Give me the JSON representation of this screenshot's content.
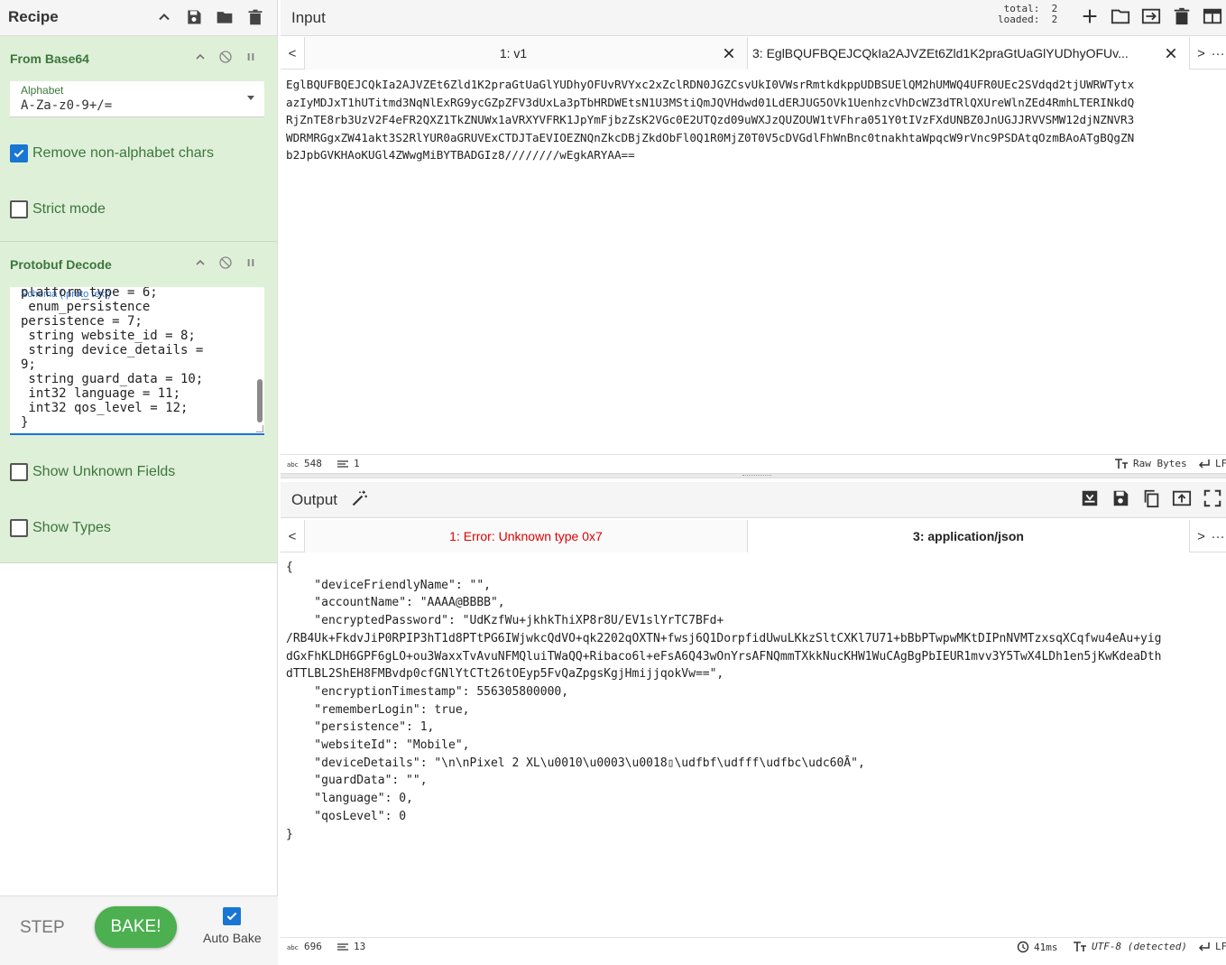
{
  "recipe": {
    "title": "Recipe",
    "from_base64": {
      "title": "From Base64",
      "alphabet_label": "Alphabet",
      "alphabet_value": "A-Za-z0-9+/=",
      "remove_non_alpha_label": "Remove non-alphabet chars",
      "remove_non_alpha_checked": true,
      "strict_mode_label": "Strict mode",
      "strict_mode_checked": false
    },
    "protobuf_decode": {
      "title": "Protobuf Decode",
      "schema_hint": "Schema (.proto text)",
      "schema_text": "platform_type = 6;\n enum_persistence\npersistence = 7;\n string website_id = 8;\n string device_details =\n9;\n string guard_data = 10;\n int32 language = 11;\n int32 qos_level = 12;\n}",
      "show_unknown_label": "Show Unknown Fields",
      "show_unknown_checked": false,
      "show_types_label": "Show Types",
      "show_types_checked": false
    },
    "controls": {
      "step_label": "STEP",
      "bake_label": "BAKE!",
      "auto_bake_label": "Auto Bake",
      "auto_bake_checked": true
    }
  },
  "input": {
    "title": "Input",
    "total_label": "total:",
    "total_value": "2",
    "loaded_label": "loaded:",
    "loaded_value": "2",
    "tab_prev": "<",
    "tab_next": ">",
    "tab_more": "···",
    "tabs": [
      {
        "label": "1: v1"
      },
      {
        "label": "3: EglBQUFBQEJCQkIa2AJVZEt6Zld1K2praGtUaGlYUDhyOFUv..."
      }
    ],
    "text": "EglBQUFBQEJCQkIa2AJVZEt6Zld1K2praGtUaGlYUDhyOFUvRVYxc2xZclRDN0JGZCsvUkI0VWsrRmtkdkppUDBSUElQM2hUMWQ4UFR0UEc2SVdqd2tjUWRWTytx\nazIyMDJxT1hUTitmd3NqNlExRG9ycGZpZFV3dUxLa3pTbHRDWEtsN1U3MStiQmJQVHdwd01LdERJUG5OVk1UenhzcVhDcWZ3dTRlQXUreWlnZEd4RmhLTERINkdQ\nRjZnTE8rb3UzV2F4eFR2QXZ1TkZNUWx1aVRXYVFRK1JpYmFjbzZsK2VGc0E2UTQzd09uWXJzQUZOUW1tVFhra051Y0tIVzFXdUNBZ0JnUGJJRVVSMW12djNZNVR3\nWDRMRGgxZW41akt3S2RlYUR0aGRUVExCTDJTaEVIOEZNQnZkcDBjZkdObFl0Q1R0MjZ0T0V5cDVGdlFhWnBnc0tnakhtaWpqcW9rVnc9PSDAtqOzmBAoATgBQgZN\nb2JpbGVKHAoKUGl4ZWwgMiBYTBADGIz8////////wEgkARYAA==",
    "status_chars": "548",
    "status_lines": "1",
    "status_format": "Raw Bytes",
    "status_eol": "LF"
  },
  "output": {
    "title": "Output",
    "tab_prev": "<",
    "tab_next": ">",
    "tab_more": "···",
    "tabs": [
      {
        "label": "1: Error: Unknown type 0x7",
        "color": "#e00000"
      },
      {
        "label": "3: application/json",
        "color": "#222222"
      }
    ],
    "text": "{\n    \"deviceFriendlyName\": \"\",\n    \"accountName\": \"AAAA@BBBB\",\n    \"encryptedPassword\": \"UdKzfWu+jkhkThiXP8r8U/EV1slYrTC7BFd+\n/RB4Uk+FkdvJiP0RPIP3hT1d8PTtPG6IWjwkcQdVO+qk2202qOXTN+fwsj6Q1DorpfidUwuLKkzSltCXKl7U71+bBbPTwpwMKtDIPnNVMTzxsqXCqfwu4eAu+yig\ndGxFhKLDH6GPF6gLO+ou3WaxxTvAvuNFMQluiTWaQQ+Ribaco6l+eFsA6Q43wOnYrsAFNQmmTXkkNucKHW1WuCAgBgPbIEUR1mvv3Y5TwX4LDh1en5jKwKdeaDth\ndTTLBL2ShEH8FMBvdp0cfGNlYtCTt26tOEyp5FvQaZpgsKgjHmijjqokVw==\",\n    \"encryptionTimestamp\": 556305800000,\n    \"rememberLogin\": true,\n    \"persistence\": 1,\n    \"websiteId\": \"Mobile\",\n    \"deviceDetails\": \"\\n\\nPixel 2 XL\\u0010\\u0003\\u0018▯\\udfbf\\udfff\\udfbc\\udc60Ā\",\n    \"guardData\": \"\",\n    \"language\": 0,\n    \"qosLevel\": 0\n}",
    "status_chars": "696",
    "status_lines": "13",
    "status_time": "41ms",
    "status_encoding": "UTF-8 (detected)",
    "status_eol": "LF"
  }
}
